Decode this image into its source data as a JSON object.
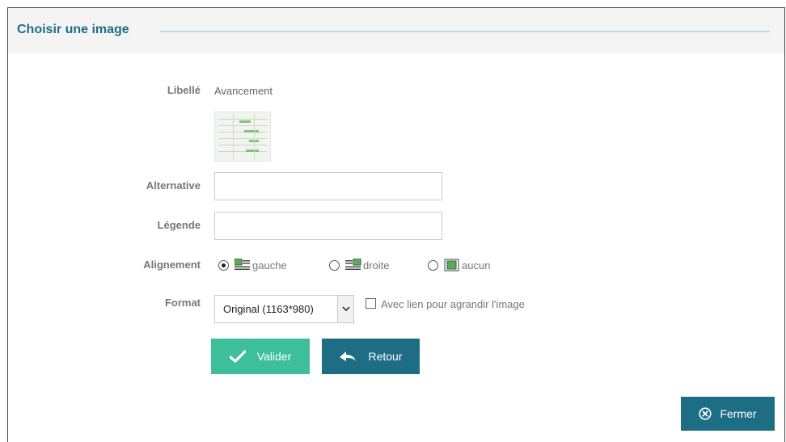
{
  "dialog": {
    "title": "Choisir une image"
  },
  "form": {
    "libelle_label": "Libellé",
    "libelle_value": "Avancement",
    "alternative_label": "Alternative",
    "alternative_value": "",
    "legende_label": "Légende",
    "legende_value": "",
    "alignement_label": "Alignement",
    "alignement_options": [
      {
        "label": "gauche",
        "icon": "align-left-icon",
        "checked": true
      },
      {
        "label": "droite",
        "icon": "align-right-icon",
        "checked": false
      },
      {
        "label": "aucun",
        "icon": "align-none-icon",
        "checked": false
      }
    ],
    "format_label": "Format",
    "format_selected": "Original (1163*980)",
    "enlarge_link_label": "Avec lien pour agrandir l'image",
    "enlarge_link_checked": false
  },
  "buttons": {
    "valider": "Valider",
    "retour": "Retour",
    "fermer": "Fermer"
  },
  "colors": {
    "title": "#1f6d86",
    "valider_bg": "#3dbf9c",
    "retour_bg": "#1d6d85",
    "fermer_bg": "#1d6d85",
    "title_rule": "#b5dce8"
  }
}
